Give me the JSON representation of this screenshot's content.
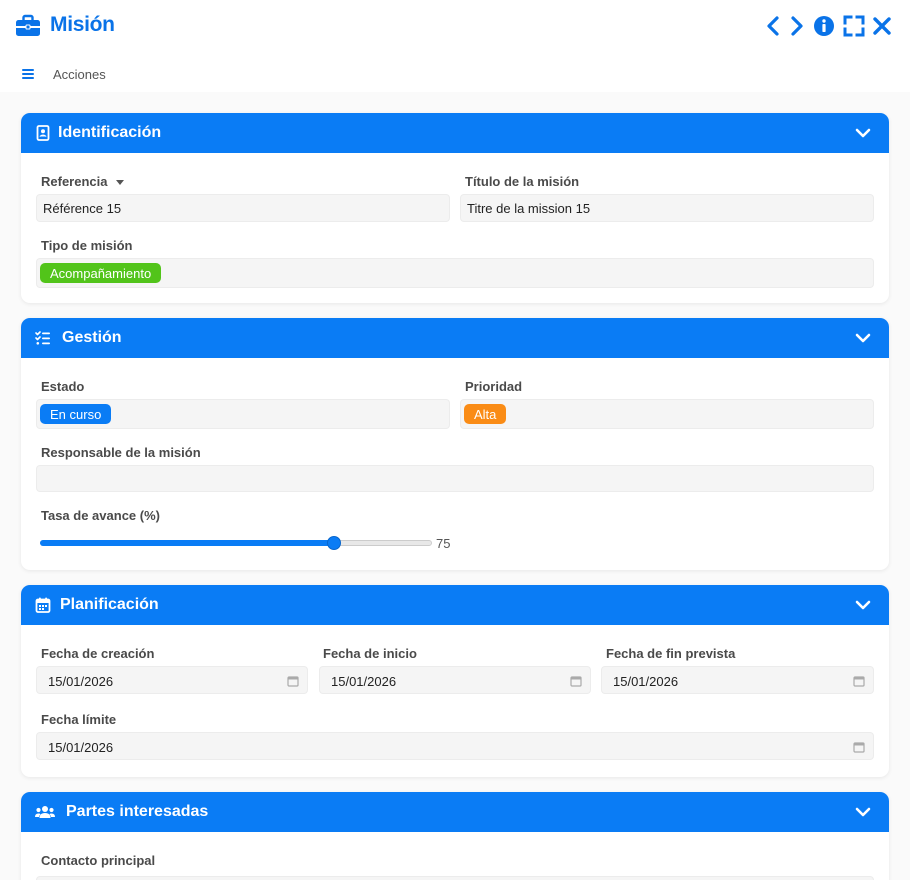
{
  "window": {
    "title": "Misión",
    "actions_label": "Acciones"
  },
  "colors": {
    "accent": "#0a7cf5",
    "tag_green": "#52c41a",
    "tag_blue": "#0a7cf5",
    "tag_orange": "#fa8c16"
  },
  "identificacion": {
    "title": "Identificación",
    "referencia_label": "Referencia",
    "referencia_value": "Référence 15",
    "titulo_label": "Título de la misión",
    "titulo_value": "Titre de la mission 15",
    "tipo_label": "Tipo de misión",
    "tipo_value": "Acompañamiento"
  },
  "gestion": {
    "title": "Gestión",
    "estado_label": "Estado",
    "estado_value": "En curso",
    "prioridad_label": "Prioridad",
    "prioridad_value": "Alta",
    "responsable_label": "Responsable de la misión",
    "responsable_value": "",
    "avance_label": "Tasa de avance (%)",
    "avance_value": "75",
    "avance_fraction": 0.75
  },
  "planificacion": {
    "title": "Planificación",
    "creacion_label": "Fecha de creación",
    "creacion_value": "15/01/2026",
    "inicio_label": "Fecha de inicio",
    "inicio_value": "15/01/2026",
    "fin_label": "Fecha de fin prevista",
    "fin_value": "15/01/2026",
    "limite_label": "Fecha límite",
    "limite_value": "15/01/2026"
  },
  "partes": {
    "title": "Partes interesadas",
    "contacto_label": "Contacto principal"
  },
  "icons": {
    "title": "briefcase-icon",
    "prev": "chevron-left-icon",
    "next": "chevron-right-icon",
    "info": "info-icon",
    "expand": "expand-icon",
    "close": "close-icon",
    "menu": "hamburger-menu-icon",
    "identificacion": "id-card-icon",
    "gestion": "task-list-icon",
    "planificacion": "calendar-icon",
    "partes": "users-icon",
    "collapse": "chevron-down-icon",
    "date": "calendar-small-icon"
  }
}
